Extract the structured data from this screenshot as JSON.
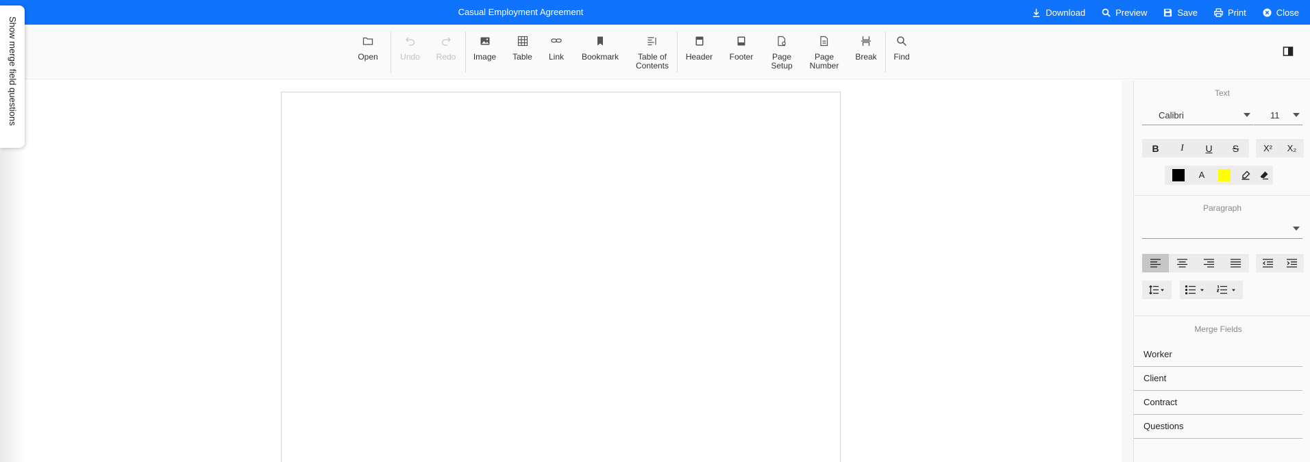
{
  "titlebar": {
    "title": "Casual Employment Agreement",
    "actions": {
      "download": "Download",
      "preview": "Preview",
      "save": "Save",
      "print": "Print",
      "close": "Close"
    }
  },
  "toolbar": {
    "open": "Open",
    "undo": "Undo",
    "redo": "Redo",
    "image": "Image",
    "table": "Table",
    "link": "Link",
    "bookmark": "Bookmark",
    "toc": "Table of\nContents",
    "header": "Header",
    "footer": "Footer",
    "page_setup": "Page\nSetup",
    "page_number": "Page\nNumber",
    "break": "Break",
    "find": "Find"
  },
  "merge_tab_label": "Show merge field questions",
  "properties": {
    "text": {
      "title": "Text",
      "font": "Calibri",
      "size": "11",
      "bold": "B",
      "italic": "I",
      "underline": "U",
      "strike": "S",
      "superscript": "X²",
      "subscript": "X₂",
      "font_color_letter": "A",
      "font_color": "#000000",
      "highlight_color": "#ffff00"
    },
    "paragraph": {
      "title": "Paragraph",
      "style": ""
    },
    "merge_fields": {
      "title": "Merge Fields",
      "items": [
        "Worker",
        "Client",
        "Contract",
        "Questions"
      ]
    }
  },
  "colors": {
    "accent": "#1073fb",
    "toolbar_bg": "#fafafa",
    "panel_bg": "#fafafa"
  }
}
